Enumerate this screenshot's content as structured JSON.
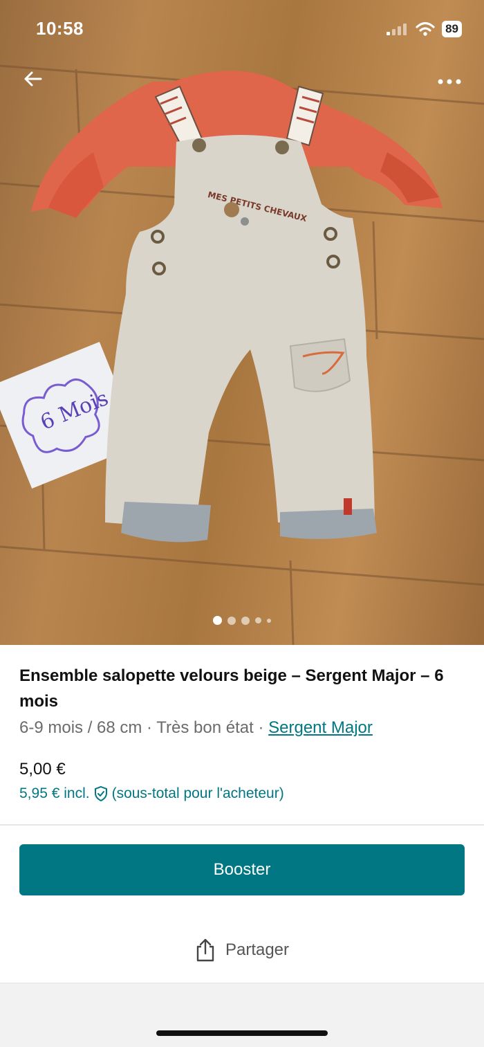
{
  "status_bar": {
    "time": "10:58",
    "battery": "89"
  },
  "photo": {
    "note_text": "6 Mois",
    "label_text": "MES PETITS CHEVAUX",
    "image_count": 5,
    "active_index": 0
  },
  "listing": {
    "title": "Ensemble salopette velours beige – Sergent Major – 6 mois",
    "size_condition": "6-9 mois / 68 cm · Très bon état · ",
    "brand": "Sergent Major",
    "price": "5,00 €",
    "price_incl": "5,95 € incl.",
    "price_incl_note": "(sous-total pour l'acheteur)"
  },
  "actions": {
    "booster_label": "Booster",
    "share_label": "Partager"
  },
  "colors": {
    "accent": "#007782",
    "shirt": "#e0664b",
    "overall": "#d7d3c8",
    "floor": "#b07d48"
  },
  "icons": {
    "back": "arrow-left-icon",
    "more": "more-dots-icon",
    "share": "share-icon",
    "protection": "shield-check-icon"
  }
}
